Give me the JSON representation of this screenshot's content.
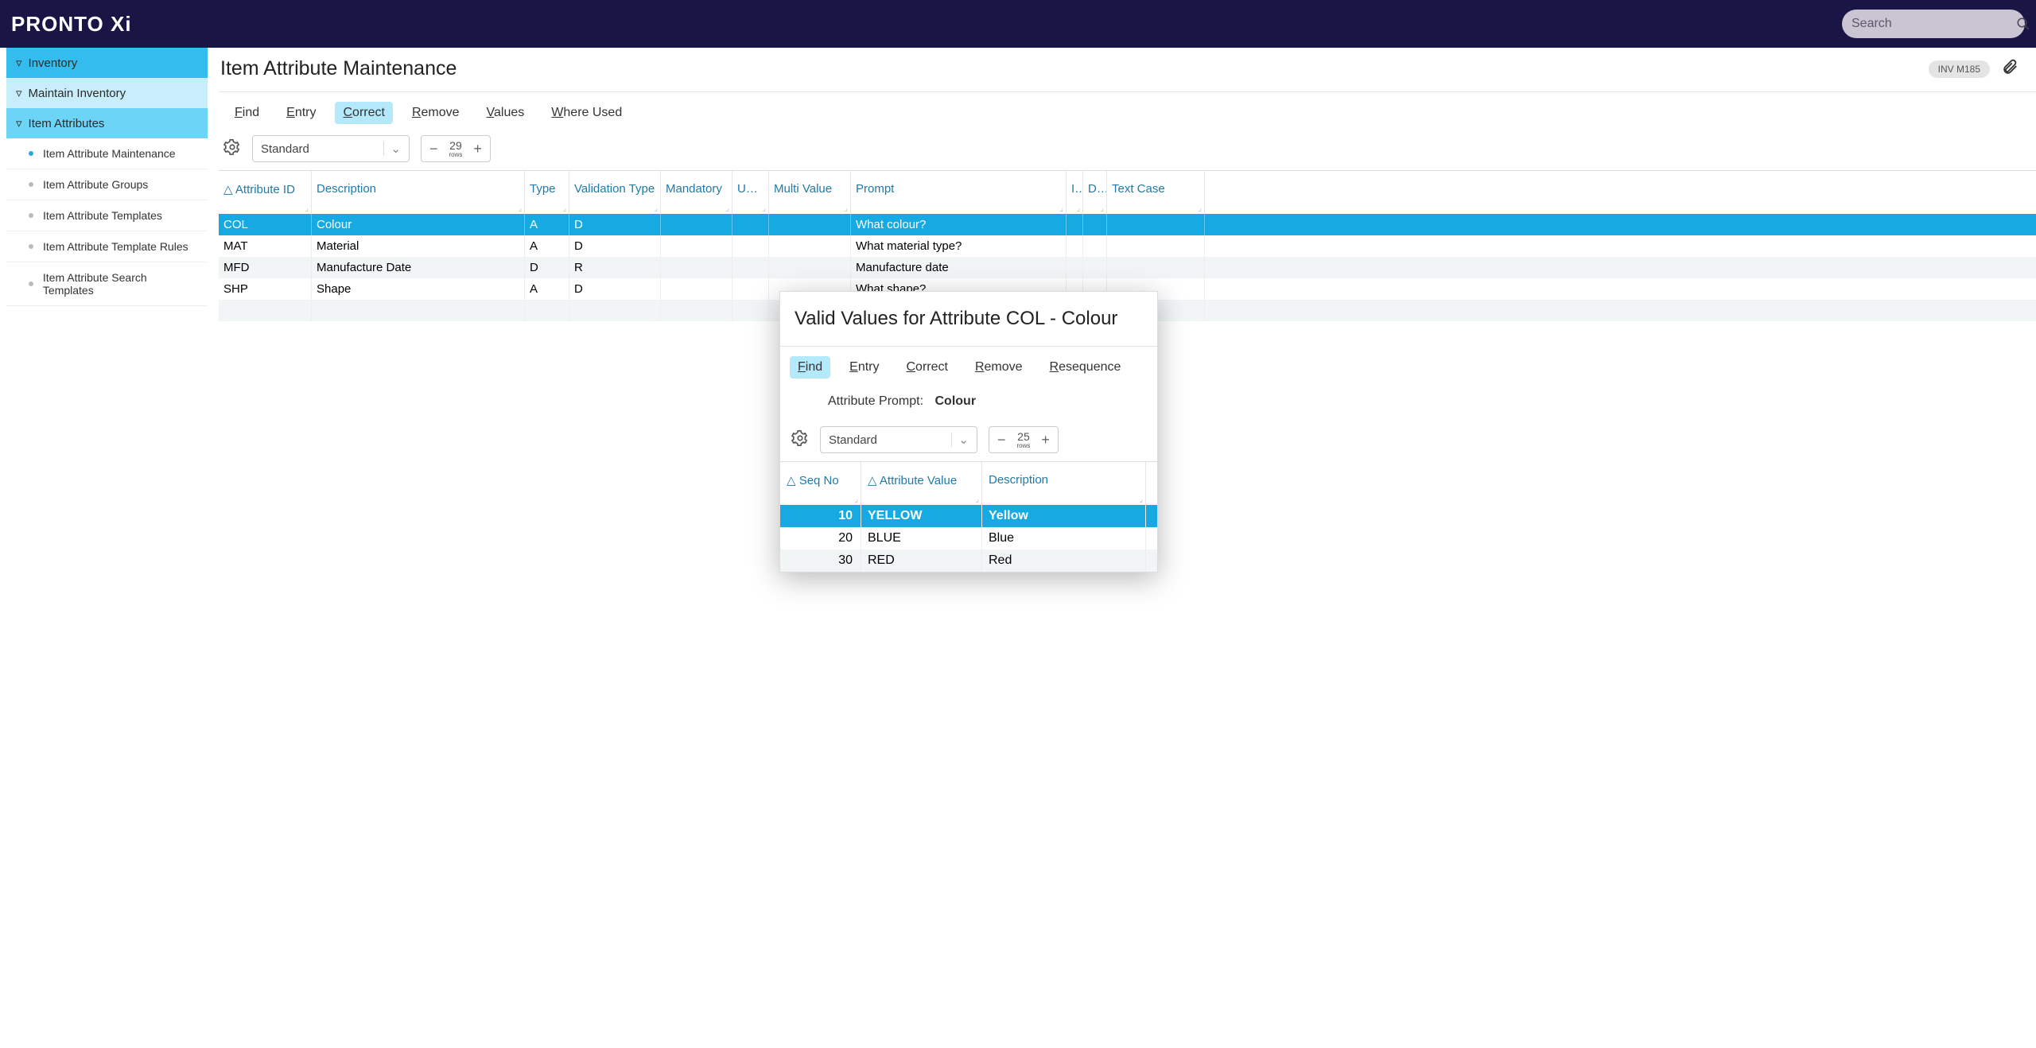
{
  "brand": "PRONTO Xi",
  "search_placeholder": "Search",
  "sidebar": {
    "level1": "Inventory",
    "level2": "Maintain Inventory",
    "level3": "Item Attributes",
    "leaves": [
      "Item Attribute Maintenance",
      "Item Attribute Groups",
      "Item Attribute Templates",
      "Item Attribute Template Rules",
      "Item Attribute Search Templates"
    ]
  },
  "page": {
    "title": "Item Attribute Maintenance",
    "code": "INV M185"
  },
  "actions": [
    "Find",
    "Entry",
    "Correct",
    "Remove",
    "Values",
    "Where Used"
  ],
  "actions_active": "Correct",
  "view_name": "Standard",
  "rows_count": "29",
  "rows_label": "rows",
  "columns": [
    "Attribute ID",
    "Description",
    "Type",
    "Validation Type",
    "Mandatory",
    "UOM",
    "Multi Value",
    "Prompt",
    "I…",
    "D…",
    "Text Case"
  ],
  "rows": [
    {
      "id": "COL",
      "desc": "Colour",
      "type": "A",
      "val": "D",
      "mand": "",
      "uom": "",
      "multi": "",
      "prompt": "What colour?",
      "i": "",
      "d": "",
      "tc": ""
    },
    {
      "id": "MAT",
      "desc": "Material",
      "type": "A",
      "val": "D",
      "mand": "",
      "uom": "",
      "multi": "",
      "prompt": "What material type?",
      "i": "",
      "d": "",
      "tc": ""
    },
    {
      "id": "MFD",
      "desc": "Manufacture Date",
      "type": "D",
      "val": "R",
      "mand": "",
      "uom": "",
      "multi": "",
      "prompt": "Manufacture date",
      "i": "",
      "d": "",
      "tc": ""
    },
    {
      "id": "SHP",
      "desc": "Shape",
      "type": "A",
      "val": "D",
      "mand": "",
      "uom": "",
      "multi": "",
      "prompt": "What shape?",
      "i": "",
      "d": "",
      "tc": ""
    }
  ],
  "popup": {
    "title": "Valid Values for Attribute COL - Colour",
    "actions": [
      "Find",
      "Entry",
      "Correct",
      "Remove",
      "Resequence"
    ],
    "actions_active": "Find",
    "prompt_label": "Attribute Prompt:",
    "prompt_value": "Colour",
    "view_name": "Standard",
    "rows_count": "25",
    "rows_label": "rows",
    "columns": [
      "Seq No",
      "Attribute Value",
      "Description"
    ],
    "rows": [
      {
        "seq": "10",
        "val": "YELLOW",
        "desc": "Yellow"
      },
      {
        "seq": "20",
        "val": "BLUE",
        "desc": "Blue"
      },
      {
        "seq": "30",
        "val": "RED",
        "desc": "Red"
      }
    ]
  }
}
